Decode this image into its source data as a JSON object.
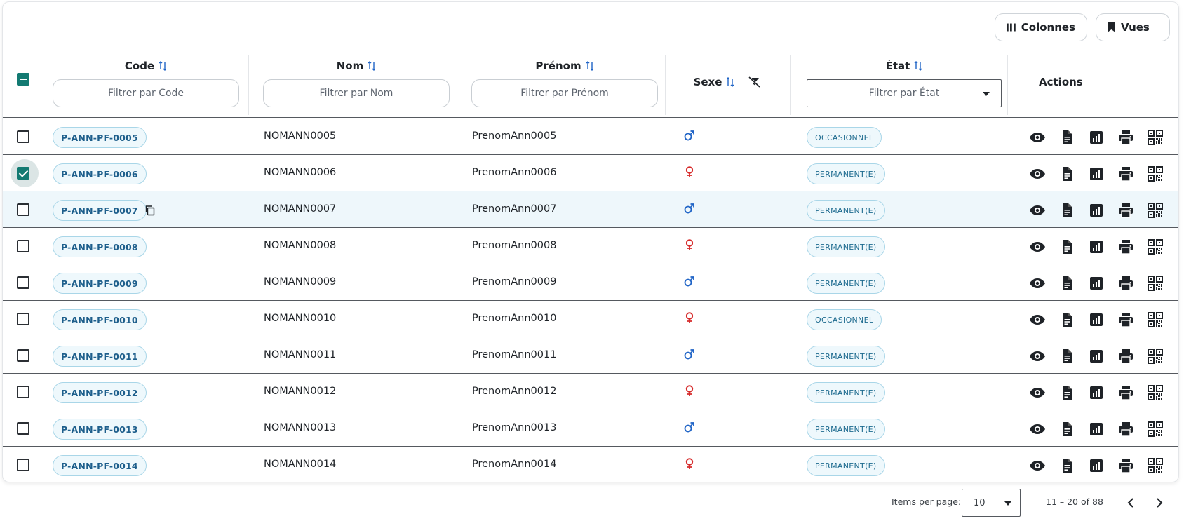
{
  "toolbar": {
    "colonnes_label": "Colonnes",
    "vues_label": "Vues"
  },
  "columns": {
    "code": {
      "label": "Code",
      "filter_placeholder": "Filtrer par Code"
    },
    "nom": {
      "label": "Nom",
      "filter_placeholder": "Filtrer par Nom"
    },
    "prenom": {
      "label": "Prénom",
      "filter_placeholder": "Filtrer par Prénom"
    },
    "sexe": {
      "label": "Sexe"
    },
    "etat": {
      "label": "État",
      "filter_placeholder": "Filtrer par État"
    },
    "actions": {
      "label": "Actions"
    }
  },
  "colors": {
    "accent": "#137a72",
    "chip_border": "#a9d6e8",
    "chip_bg": "#eef8fc",
    "chip_text": "#1e5f8c",
    "male": "#1e63c6",
    "female": "#d62a2a"
  },
  "rows": [
    {
      "code": "P-ANN-PF-0005",
      "nom": "NOMANN0005",
      "prenom": "PrenomAnn0005",
      "sexe": "male",
      "etat": "OCCASIONNEL",
      "checked": false
    },
    {
      "code": "P-ANN-PF-0006",
      "nom": "NOMANN0006",
      "prenom": "PrenomAnn0006",
      "sexe": "female",
      "etat": "PERMANENT(E)",
      "checked": true
    },
    {
      "code": "P-ANN-PF-0007",
      "nom": "NOMANN0007",
      "prenom": "PrenomAnn0007",
      "sexe": "male",
      "etat": "PERMANENT(E)",
      "checked": false,
      "hover": true
    },
    {
      "code": "P-ANN-PF-0008",
      "nom": "NOMANN0008",
      "prenom": "PrenomAnn0008",
      "sexe": "female",
      "etat": "PERMANENT(E)",
      "checked": false
    },
    {
      "code": "P-ANN-PF-0009",
      "nom": "NOMANN0009",
      "prenom": "PrenomAnn0009",
      "sexe": "male",
      "etat": "PERMANENT(E)",
      "checked": false
    },
    {
      "code": "P-ANN-PF-0010",
      "nom": "NOMANN0010",
      "prenom": "PrenomAnn0010",
      "sexe": "female",
      "etat": "OCCASIONNEL",
      "checked": false
    },
    {
      "code": "P-ANN-PF-0011",
      "nom": "NOMANN0011",
      "prenom": "PrenomAnn0011",
      "sexe": "male",
      "etat": "PERMANENT(E)",
      "checked": false
    },
    {
      "code": "P-ANN-PF-0012",
      "nom": "NOMANN0012",
      "prenom": "PrenomAnn0012",
      "sexe": "female",
      "etat": "PERMANENT(E)",
      "checked": false
    },
    {
      "code": "P-ANN-PF-0013",
      "nom": "NOMANN0013",
      "prenom": "PrenomAnn0013",
      "sexe": "male",
      "etat": "PERMANENT(E)",
      "checked": false
    },
    {
      "code": "P-ANN-PF-0014",
      "nom": "NOMANN0014",
      "prenom": "PrenomAnn0014",
      "sexe": "female",
      "etat": "PERMANENT(E)",
      "checked": false
    }
  ],
  "row_actions": [
    "eye-icon",
    "document-icon",
    "report-icon",
    "print-icon",
    "qr-code-icon"
  ],
  "pagination": {
    "items_per_page_label": "Items per page:",
    "page_size": "10",
    "range": "11 – 20 of 88"
  }
}
